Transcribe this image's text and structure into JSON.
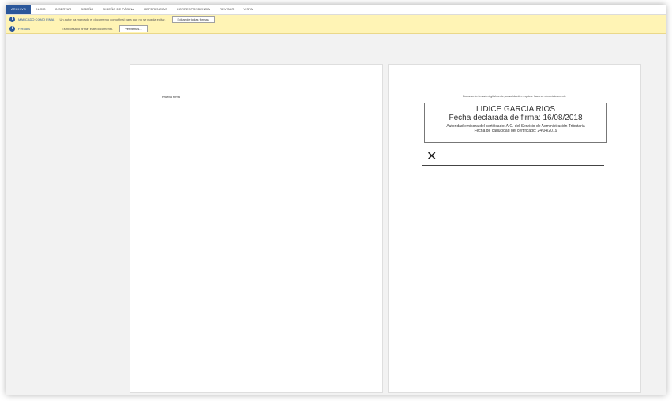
{
  "ribbon": {
    "tabs": [
      {
        "label": "ARCHIVO",
        "active": true
      },
      {
        "label": "INICIO"
      },
      {
        "label": "INSERTAR"
      },
      {
        "label": "DISEÑO"
      },
      {
        "label": "DISEÑO DE PÁGINA"
      },
      {
        "label": "REFERENCIAS"
      },
      {
        "label": "CORRESPONDENCIA"
      },
      {
        "label": "REVISAR"
      },
      {
        "label": "VISTA"
      }
    ]
  },
  "message_bars": [
    {
      "icon": "info-icon",
      "title": "MARCADO COMO FINAL",
      "text": "Un autor ha marcado el documento como final para que no se pueda editar.",
      "button": "Editar de todas formas"
    },
    {
      "icon": "info-icon",
      "title": "FIRMAS",
      "text": "Es necesario firmar este documento.",
      "button": "Ver firmas..."
    }
  ],
  "pages": {
    "left": {
      "text": "Prueba firma"
    },
    "right": {
      "note": "Documento firmado digitalmente, su validación requiere hacerse electrónicamente",
      "signer": "LIDICE GARCIA RIOS",
      "date": "Fecha declarada de firma: 16/08/2018",
      "authority": "Autoridad emisora del certificado: A.C. del Servicio de Administración Tributaria",
      "expiry": "Fecha de caducidad del certificado: 24/04/2019",
      "mark": "✕"
    }
  },
  "colors": {
    "accent": "#2b579a",
    "message_bar": "#fff4b5",
    "workspace": "#f2f2f2"
  }
}
